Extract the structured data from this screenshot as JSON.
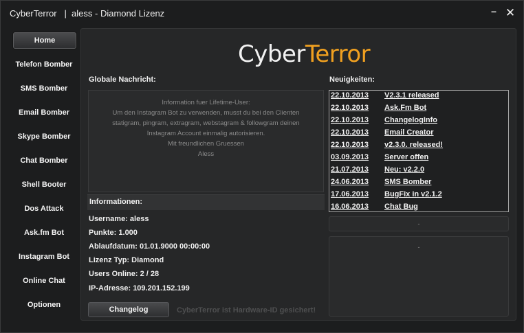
{
  "window": {
    "title": "CyberTerror   |  aless - Diamond Lizenz",
    "minimize_glyph": "–",
    "close_glyph": "✕"
  },
  "sidebar": {
    "items": [
      {
        "label": "Home",
        "active": true
      },
      {
        "label": "Telefon Bomber"
      },
      {
        "label": "SMS Bomber"
      },
      {
        "label": "Email Bomber"
      },
      {
        "label": "Skype Bomber"
      },
      {
        "label": "Chat Bomber"
      },
      {
        "label": "Shell Booter"
      },
      {
        "label": "Dos Attack"
      },
      {
        "label": "Ask.fm Bot"
      },
      {
        "label": "Instagram Bot"
      },
      {
        "label": "Online Chat"
      },
      {
        "label": "Optionen"
      }
    ]
  },
  "logo": {
    "part1": "Cyber",
    "part2": "Terror",
    "accent": "#f0a020"
  },
  "global_message": {
    "label": "Globale Nachricht:",
    "lines": [
      "Information fuer Lifetime-User:",
      "",
      "Um den Instagram Bot zu verwenden, musst du bei den Clienten",
      "statigram, pingram, extragram, webstagram & followgram deinen",
      "Instagram Account einmalig autorisieren.",
      "",
      "Mit freundlichen Gruessen",
      "Aless"
    ]
  },
  "info": {
    "label": "Informationen:",
    "lines": [
      "Username: aless",
      "Punkte: 1.000",
      "Ablaufdatum: 01.01.9000 00:00:00",
      "Lizenz Typ: Diamond",
      "Users Online: 2 / 28",
      "IP-Adresse: 109.201.152.199"
    ]
  },
  "changelog_button": "Changelog",
  "hwid_notice": "CyberTerror ist Hardware-ID gesichert!",
  "news": {
    "label": "Neuigkeiten:",
    "items": [
      {
        "date": "22.10.2013",
        "title": "V2.3.1 released"
      },
      {
        "date": "22.10.2013",
        "title": "Ask.Fm Bot"
      },
      {
        "date": "22.10.2013",
        "title": "ChangelogInfo"
      },
      {
        "date": "22.10.2013",
        "title": "Email Creator"
      },
      {
        "date": "22.10.2013",
        "title": "v2.3.0. released!"
      },
      {
        "date": "03.09.2013",
        "title": "Server offen"
      },
      {
        "date": "21.07.2013",
        "title": "Neu: v2.2.0"
      },
      {
        "date": "24.06.2013",
        "title": "SMS Bomber"
      },
      {
        "date": "17.06.2013",
        "title": "BugFix in v2.1.2"
      },
      {
        "date": "16.06.2013",
        "title": "Chat Bug"
      }
    ]
  },
  "news_status": "-",
  "news_detail": "-"
}
